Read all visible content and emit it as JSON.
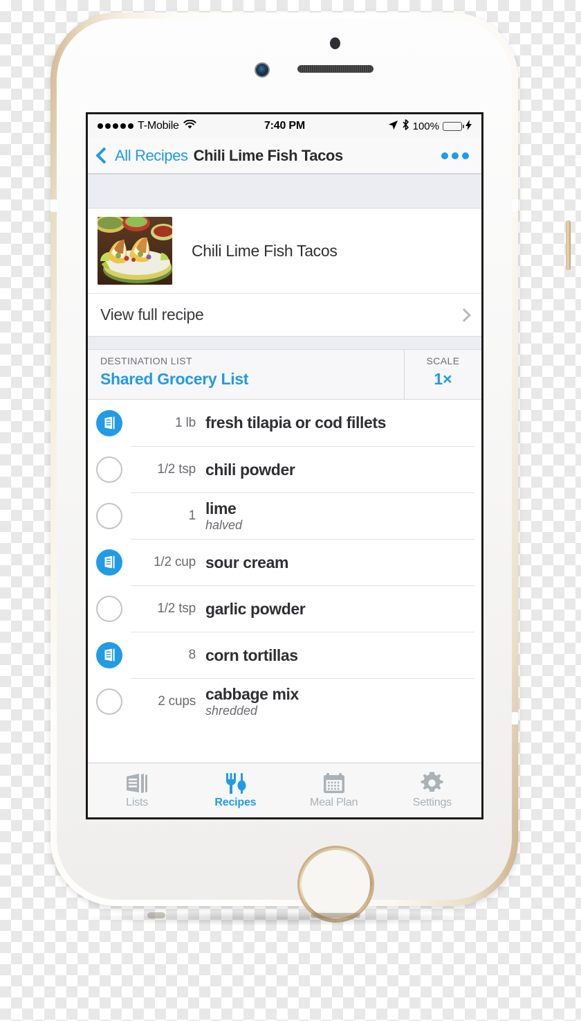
{
  "status_bar": {
    "carrier": "T-Mobile",
    "time": "7:40 PM",
    "battery_percent": "100%",
    "signal_dots": 5,
    "icons": [
      "wifi-icon",
      "location-arrow-icon",
      "bluetooth-icon",
      "battery-icon",
      "charging-bolt-icon"
    ]
  },
  "nav_bar": {
    "back_label": "All Recipes",
    "title": "Chili Lime Fish Tacos",
    "more_label": "•••"
  },
  "recipe_card": {
    "title": "Chili Lime Fish Tacos",
    "thumbnail_alt": "fish-tacos-photo"
  },
  "view_recipe": {
    "label": "View full recipe"
  },
  "destination": {
    "label": "DESTINATION LIST",
    "value": "Shared Grocery List"
  },
  "scale": {
    "label": "SCALE",
    "value": "1×"
  },
  "ingredients": [
    {
      "checked": true,
      "qty": "1 lb",
      "name": "fresh tilapia or cod fillets",
      "note": ""
    },
    {
      "checked": false,
      "qty": "1/2 tsp",
      "name": "chili powder",
      "note": ""
    },
    {
      "checked": false,
      "qty": "1",
      "name": "lime",
      "note": "halved"
    },
    {
      "checked": true,
      "qty": "1/2 cup",
      "name": "sour cream",
      "note": ""
    },
    {
      "checked": false,
      "qty": "1/2 tsp",
      "name": "garlic powder",
      "note": ""
    },
    {
      "checked": true,
      "qty": "8",
      "name": "corn tortillas",
      "note": ""
    },
    {
      "checked": false,
      "qty": "2 cups",
      "name": "cabbage mix",
      "note": "shredded"
    }
  ],
  "tab_bar": {
    "tabs": [
      {
        "label": "Lists",
        "icon": "lists-icon",
        "active": false
      },
      {
        "label": "Recipes",
        "icon": "utensils-icon",
        "active": true
      },
      {
        "label": "Meal Plan",
        "icon": "calendar-icon",
        "active": false
      },
      {
        "label": "Settings",
        "icon": "gear-icon",
        "active": false
      }
    ]
  },
  "colors": {
    "accent_blue": "#1f9be8",
    "battery_green": "#4bd964",
    "tab_inactive": "#a9b0b5",
    "band_gray": "#ecedf2"
  }
}
